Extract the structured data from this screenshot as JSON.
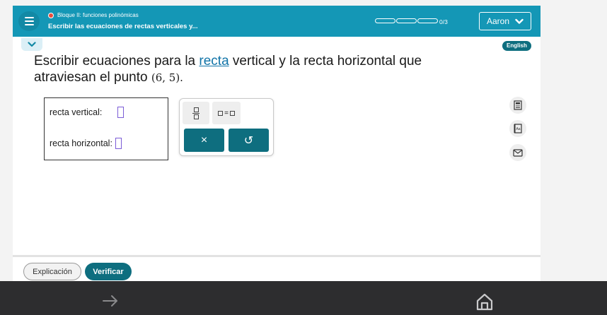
{
  "header": {
    "breadcrumb": "Bloque II: funciones polinómicas",
    "lesson_title": "Escribir las ecuaciones de rectas verticales y...",
    "progress_label": "0/3",
    "progress_done": 0,
    "progress_total": 3,
    "user_name": "Aaron",
    "record_color": "#e74c3c",
    "accent_color": "#1497b6"
  },
  "language_button": "English",
  "prompt": {
    "part1": "Escribir ecuaciones para la ",
    "link": "recta",
    "part2": " vertical y la recta horizontal que atraviesan el punto ",
    "point": "(6, 5)",
    "end": "."
  },
  "answers": {
    "vertical_label": "recta vertical:",
    "horizontal_label": "recta horizontal:"
  },
  "keypad": {
    "keys": [
      "fraction-icon",
      "equation-icon"
    ],
    "clear_symbol": "×",
    "undo_symbol": "↺"
  },
  "tools": [
    "calculator-icon",
    "glossary-icon",
    "message-icon"
  ],
  "footer": {
    "explanation_label": "Explicación",
    "verify_label": "Verificar"
  },
  "nav": {
    "icons": [
      "arrow-right-icon",
      "home-icon"
    ]
  }
}
